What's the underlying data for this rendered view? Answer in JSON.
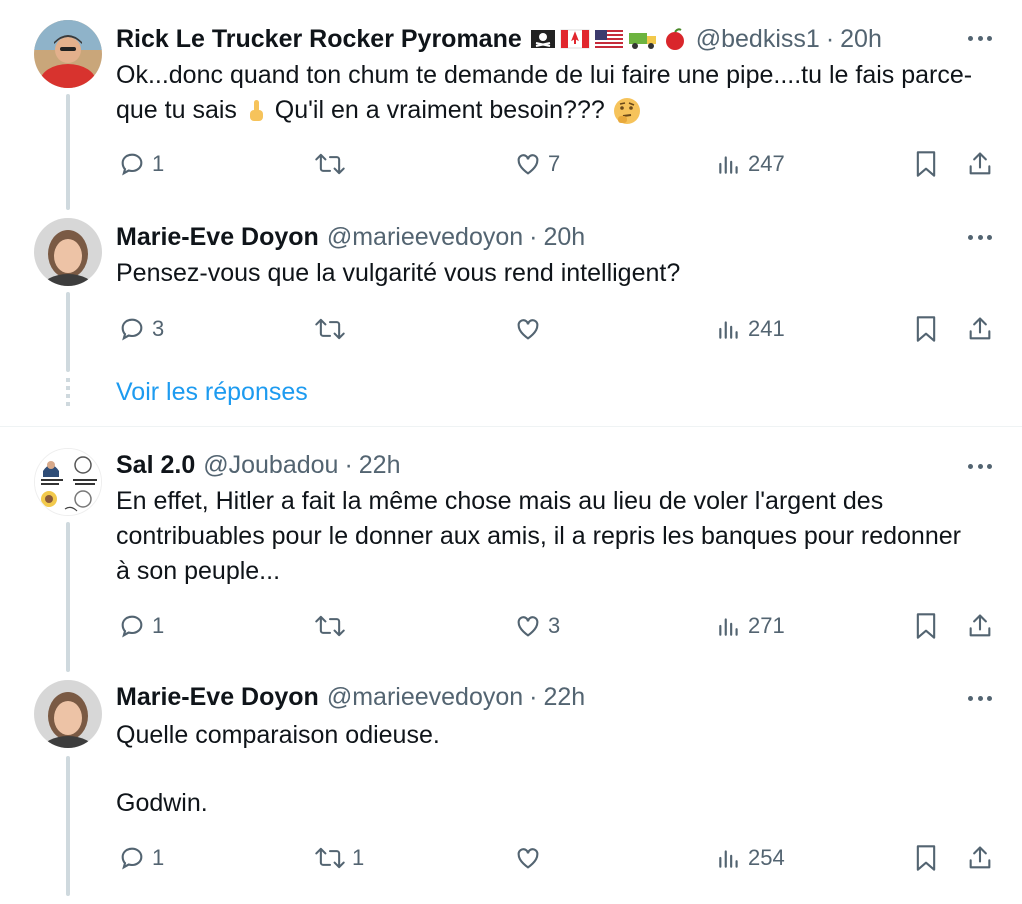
{
  "replies": [
    {
      "name": "Rick Le Trucker Rocker Pyromane",
      "handle": "@bedkiss1",
      "sep": "·",
      "time": "20h",
      "text_before_emoji": "Ok...donc quand ton chum te demande de lui faire une pipe....tu le fais parce-que tu sais ",
      "text_after_emoji": " Qu'il en a vraiment besoin??? ",
      "flags": [
        "pirate-flag-emoji",
        "canada-flag-emoji",
        "usa-flag-emoji",
        "truck-emoji",
        "apple-emoji"
      ],
      "reply_count": "1",
      "retweet_count": "",
      "like_count": "7",
      "view_count": "247"
    },
    {
      "name": "Marie-Eve Doyon",
      "handle": "@marieevedoyon",
      "sep": "·",
      "time": "20h",
      "text": "Pensez-vous que la vulgarité vous rend intelligent?",
      "reply_count": "3",
      "retweet_count": "",
      "like_count": "",
      "view_count": "241"
    },
    {
      "name": "Sal 2.0",
      "handle": "@Joubadou",
      "sep": "·",
      "time": "22h",
      "text": "En effet, Hitler a fait la même chose mais au lieu de voler l'argent des contribuables pour le donner aux amis, il a repris les banques pour redonner à son peuple...",
      "reply_count": "1",
      "retweet_count": "",
      "like_count": "3",
      "view_count": "271"
    },
    {
      "name": "Marie-Eve Doyon",
      "handle": "@marieevedoyon",
      "sep": "·",
      "time": "22h",
      "text_line1": "Quelle comparaison odieuse.",
      "text_line2": "Godwin.",
      "reply_count": "1",
      "retweet_count": "1",
      "like_count": "",
      "view_count": "254"
    }
  ],
  "show_replies_label": "Voir les réponses",
  "colors": {
    "text": "#0f1419",
    "secondary": "#536471",
    "link": "#1d9bf0",
    "thread_line": "#cfd9de"
  }
}
